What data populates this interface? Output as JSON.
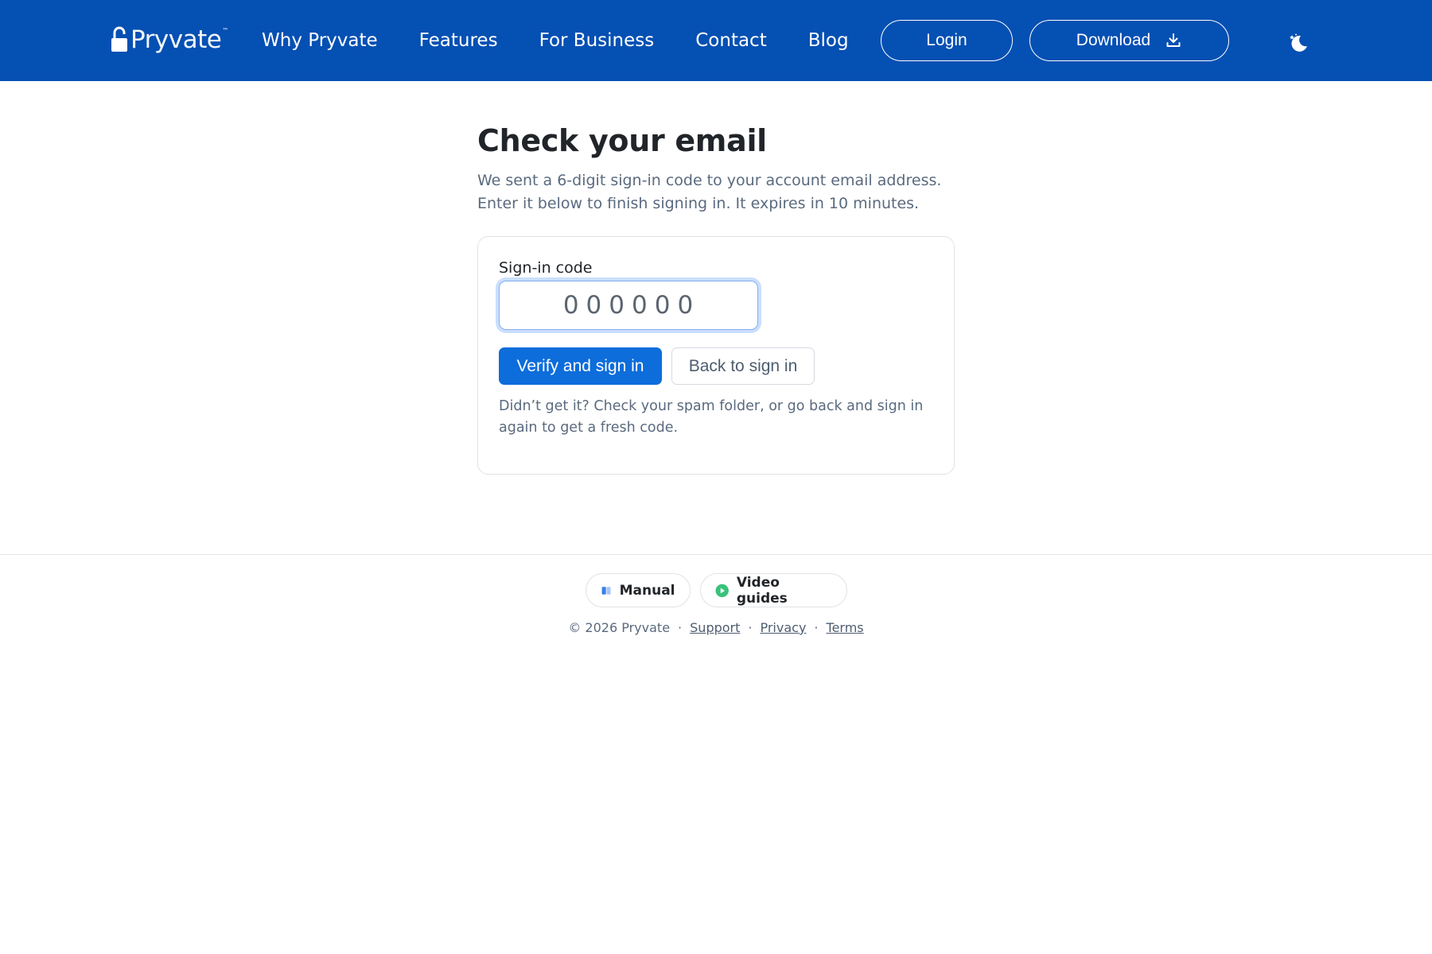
{
  "header": {
    "logo_text": "Pryvate",
    "logo_tm": "™",
    "nav": [
      {
        "label": "Why Pryvate"
      },
      {
        "label": "Features"
      },
      {
        "label": "For Business"
      },
      {
        "label": "Contact"
      },
      {
        "label": "Blog"
      }
    ],
    "login_label": "Login",
    "download_label": "Download"
  },
  "main": {
    "title": "Check your email",
    "description": "We sent a 6-digit sign-in code to your account email address. Enter it below to finish signing in. It expires in 10 minutes.",
    "form": {
      "code_label": "Sign-in code",
      "code_placeholder": "000000",
      "verify_label": "Verify and sign in",
      "back_label": "Back to sign in",
      "help_text": "Didn’t get it? Check your spam folder, or go back and sign in again to get a fresh code."
    }
  },
  "footer": {
    "pills": [
      {
        "label": "Manual",
        "icon": "book-icon"
      },
      {
        "label": "Video guides",
        "icon": "play-circle-icon"
      }
    ],
    "copyright": "© 2026 Pryvate",
    "links": [
      {
        "label": "Support"
      },
      {
        "label": "Privacy"
      },
      {
        "label": "Terms"
      }
    ],
    "separator": "·"
  },
  "colors": {
    "brand_header": "#0550b3",
    "primary_button": "#0d6ddb",
    "video_icon": "#3ac27a",
    "manual_icon": "#3a7ee8"
  }
}
